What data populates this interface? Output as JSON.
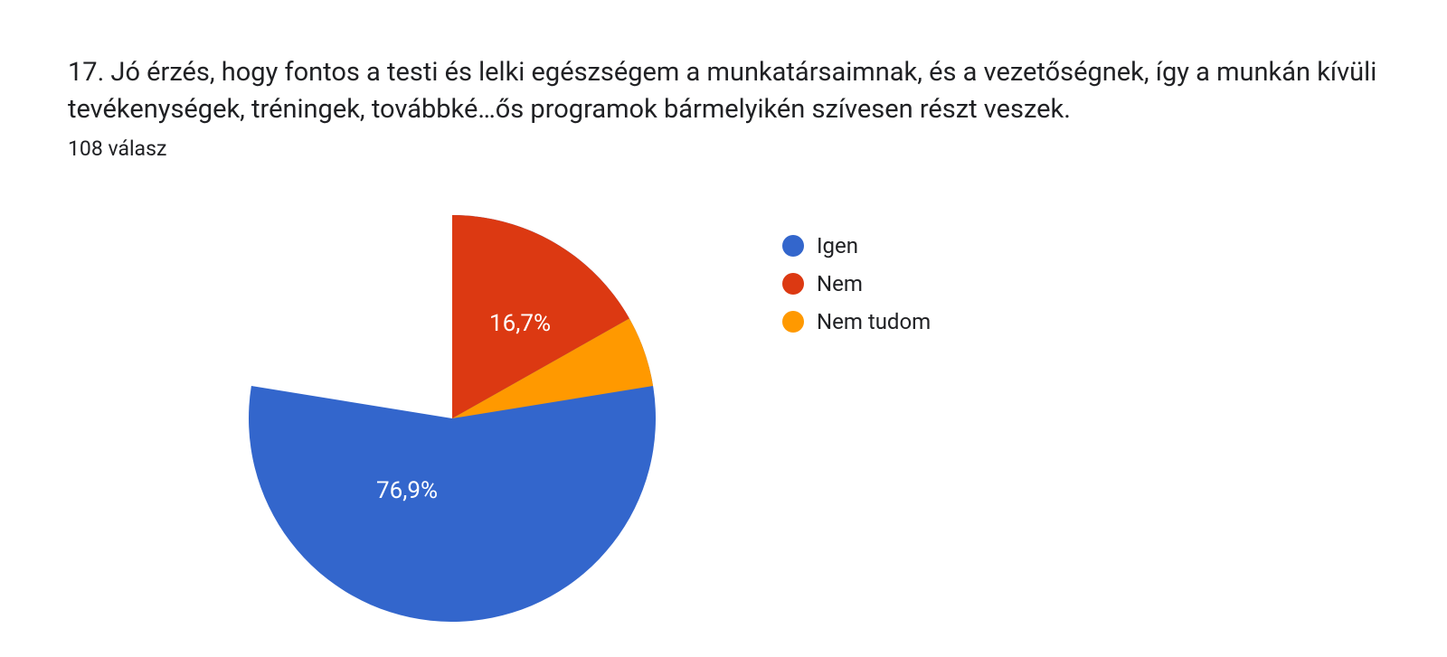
{
  "title": "17. Jó érzés, hogy fontos a testi és lelki egészségem a munkatársaimnak, és a vezetőségnek, így a munkán kívüli tevékenységek, tréningek, továbbké…ős programok bármelyikén szívesen részt veszek.",
  "subtitle": "108 válasz",
  "chart_data": {
    "type": "pie",
    "title": "17. Jó érzés, hogy fontos a testi és lelki egészségem a munkatársaimnak, és a vezetőségnek, így a munkán kívüli tevékenységek, tréningek, továbbké…ős programok bármelyikén szívesen részt veszek.",
    "total_responses": 108,
    "series": [
      {
        "name": "Igen",
        "value": 76.9,
        "color": "#3366cc"
      },
      {
        "name": "Nem",
        "value": 16.7,
        "color": "#dc3912"
      },
      {
        "name": "Nem tudom",
        "value": 6.4,
        "color": "#ff9900"
      }
    ],
    "visible_labels": [
      "76,9%",
      "16,7%"
    ]
  },
  "legend": {
    "items": [
      {
        "label": "Igen",
        "color": "#3366cc"
      },
      {
        "label": "Nem",
        "color": "#dc3912"
      },
      {
        "label": "Nem tudom",
        "color": "#ff9900"
      }
    ]
  },
  "labels": {
    "slice_igen": "76,9%",
    "slice_nem": "16,7%"
  }
}
